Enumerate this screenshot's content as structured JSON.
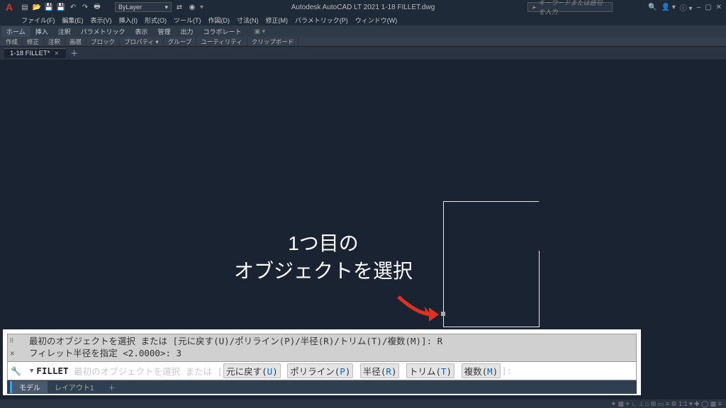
{
  "title": "Autodesk AutoCAD LT 2021   1-18 FILLET.dwg",
  "search_hint": "キーワードまたは語句を入力",
  "menu": [
    "ファイル(F)",
    "編集(E)",
    "表示(V)",
    "挿入(I)",
    "形式(O)",
    "ツール(T)",
    "作図(D)",
    "寸法(N)",
    "修正(M)",
    "パラメトリック(P)",
    "ウィンドウ(W)"
  ],
  "ribbon_tabs": [
    "ホーム",
    "挿入",
    "注釈",
    "パラメトリック",
    "表示",
    "管理",
    "出力",
    "コラボレート"
  ],
  "ribbon_panels": [
    "作成",
    "修正",
    "注釈",
    "画層",
    "ブロック",
    "プロパティ ▾",
    "グループ",
    "ユーティリティ",
    "クリップボード"
  ],
  "doc_tab": "1-18 FILLET*",
  "layer_label": "ByLayer",
  "annotation_l1": "1つ目の",
  "annotation_l2": "オブジェクトを選択",
  "history": {
    "l1_pre": "最初のオブジェクトを選択 または [元に戻す(U)/ポリライン(P)/半径(R)/トリム(T)/複数(M)]: ",
    "l1_val": "R",
    "l2_pre": "フィレット半径を指定 <2.0000>: ",
    "l2_val": "3"
  },
  "cmd": {
    "name": "FILLET",
    "prompt_pre": "最初のオブジェクトを選択 または [",
    "opts": [
      {
        "t": "元に戻す",
        "k": "U"
      },
      {
        "t": "ポリライン",
        "k": "P"
      },
      {
        "t": "半径",
        "k": "R"
      },
      {
        "t": "トリム",
        "k": "T"
      },
      {
        "t": "複数",
        "k": "M"
      }
    ],
    "prompt_post": "]:"
  },
  "layout_tabs": {
    "active": "モデル",
    "other": "レイアウト1"
  },
  "status_icons": "✦ ▦ ⌖ ∟ ⟂ ⌂ ⊞ ▭ ≡ ⚙ 1:1 ▾ ✚ ◯ ▦ ≡"
}
